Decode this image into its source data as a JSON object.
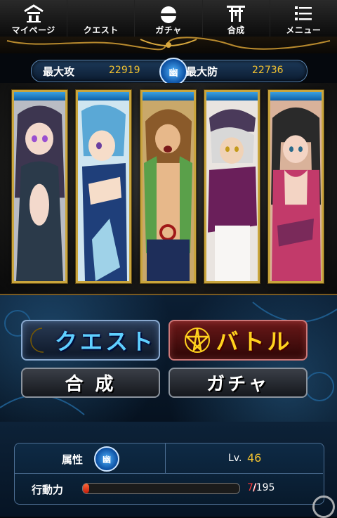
{
  "nav": {
    "items": [
      {
        "label": "マイページ",
        "icon": "home-icon"
      },
      {
        "label": "クエスト",
        "icon": "moon-icon"
      },
      {
        "label": "ガチャ",
        "icon": "gacha-ball-icon"
      },
      {
        "label": "合成",
        "icon": "torii-icon"
      },
      {
        "label": "メニュー",
        "icon": "menu-icon"
      }
    ]
  },
  "stats": {
    "attack_label": "最大攻",
    "attack_value": "22919",
    "emblem": "幽",
    "defense_label": "最大防",
    "defense_value": "22736"
  },
  "cards": [
    {
      "hair": "#3d3650",
      "skin": "#f3d9cc",
      "outfit": "#2b3a4a",
      "bg": "#b9bcc4"
    },
    {
      "hair": "#5aa8d6",
      "skin": "#f6ddc9",
      "outfit": "#1f3f7a",
      "bg": "#cfe5f0"
    },
    {
      "hair": "#8a5a2a",
      "skin": "#e7b88a",
      "outfit": "#5aa04a",
      "bg": "#c9a86a"
    },
    {
      "hair": "#d8d8d8",
      "skin": "#f0d2b6",
      "outfit": "#6a1f5a",
      "bg": "#e9e4e0"
    },
    {
      "hair": "#2a2a2a",
      "skin": "#f3d4c4",
      "outfit": "#c23a6a",
      "bg": "#d9b29a"
    }
  ],
  "actions": {
    "quest_label": "クエスト",
    "battle_label": "バトル",
    "fuse_label": "合 成",
    "gacha_label": "ガチャ"
  },
  "status": {
    "attribute_label": "属性",
    "attribute_icon": "幽",
    "level_label": "Lv.",
    "level_value": "46",
    "ap_label": "行動力",
    "ap_current": "7/",
    "ap_max": "/195",
    "ap_fraction": 0.036
  },
  "colors": {
    "accent_gold": "#c9a53d",
    "value_yellow": "#f2c230",
    "ap_red": "#ff3b3b"
  }
}
